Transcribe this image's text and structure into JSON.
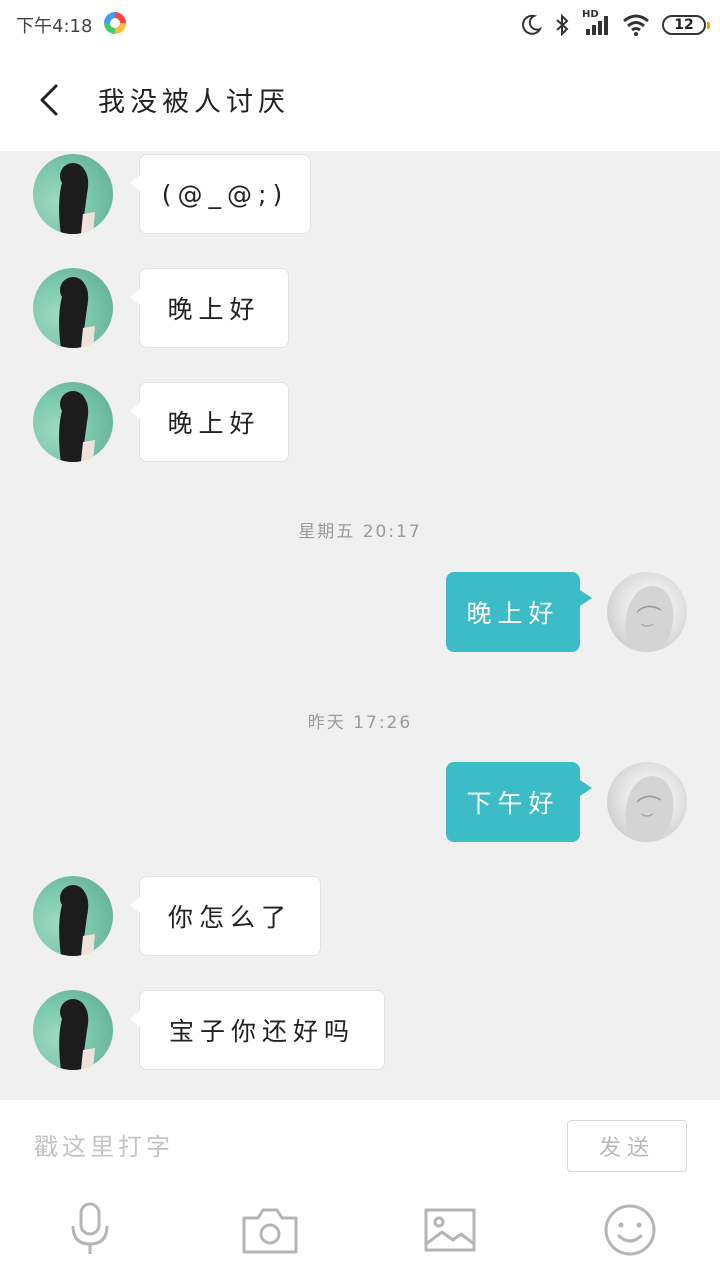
{
  "status_bar": {
    "time": "下午4:18",
    "battery": "12",
    "network": "HD",
    "icons": [
      "color-app-icon",
      "moon-icon",
      "bluetooth-icon",
      "signal-icon",
      "wifi-icon",
      "battery-icon"
    ]
  },
  "header": {
    "title": "我没被人讨厌",
    "back_icon": "chevron-left-icon"
  },
  "messages": [
    {
      "side": "in",
      "text": "(@_@;)"
    },
    {
      "side": "in",
      "text": "晚上好"
    },
    {
      "side": "in",
      "text": "晚上好"
    },
    {
      "stamp": "星期五  20:17"
    },
    {
      "side": "out",
      "text": "晚上好"
    },
    {
      "stamp": "昨天  17:26"
    },
    {
      "side": "out",
      "text": "下午好"
    },
    {
      "side": "in",
      "text": "你怎么了"
    },
    {
      "side": "in",
      "text": "宝子你还好吗"
    }
  ],
  "composer": {
    "placeholder": "戳这里打字",
    "send_label": "发送"
  },
  "toolbar": {
    "items": [
      "microphone-icon",
      "camera-icon",
      "image-icon",
      "emoji-icon"
    ]
  },
  "colors": {
    "outgoing_bubble": "#3bbcc6",
    "chat_background": "#f0f0f0"
  }
}
